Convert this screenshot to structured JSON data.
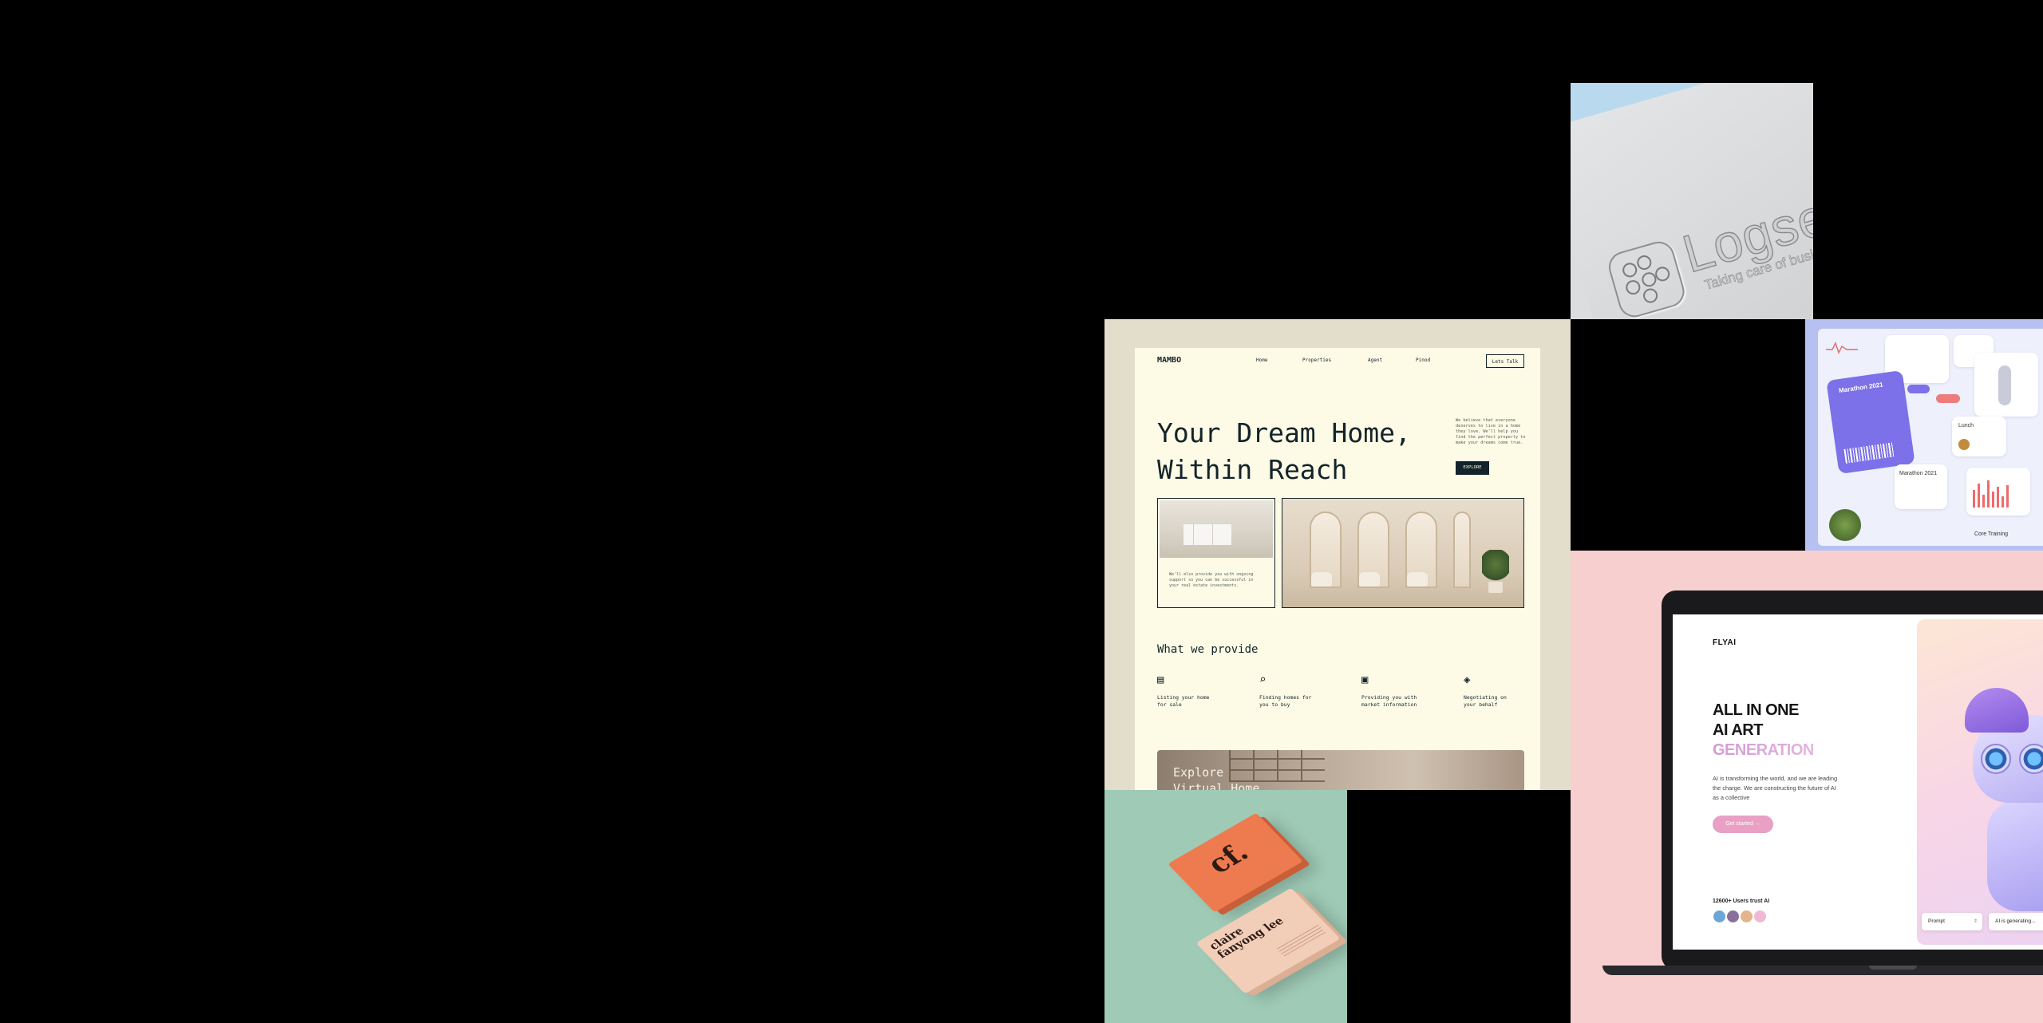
{
  "logseq": {
    "wordmark": "Logseq",
    "tagline": "Taking care of business"
  },
  "fitness": {
    "ticket_title": "Marathon 2021",
    "lunch": "Lunch",
    "marathon_card": "Marathon 2021",
    "core": "Core Training"
  },
  "mambo": {
    "brand": "MAMBO",
    "nav": [
      "Home",
      "Properties",
      "Agent",
      "Pinod"
    ],
    "talk_button": "Lets Talk",
    "hero": "Your Dream Home,\nWithin Reach",
    "blurb": "We believe that everyone deserves to live in a home they love. We'll help you find the perfect property to make your dreams come true.",
    "explore_button": "EXPLORE",
    "photo_caption": "We'll also provide you with ongoing support so you can be successful in your real estate investments.",
    "section_title": "What we provide",
    "services": [
      {
        "icon": "document-icon",
        "glyph": "▤",
        "label": "Listing your home\nfor sale"
      },
      {
        "icon": "search-home-icon",
        "glyph": "⌕",
        "label": "Finding homes for\nyou to buy"
      },
      {
        "icon": "chart-icon",
        "glyph": "▣",
        "label": "Providing you with\nmarket information"
      },
      {
        "icon": "coins-icon",
        "glyph": "◈",
        "label": "Negotiating on\nyour behalf"
      }
    ],
    "banner_title": "Explore\nVirtual Home"
  },
  "cards": {
    "logo": "cf.",
    "name": "claire\nfanyong lee"
  },
  "flyai": {
    "logo": "FLYAI",
    "headline_1": "ALL IN ONE",
    "headline_2": "AI ART",
    "headline_3": "GENERATION",
    "subtitle": "AI is transforming the world, and we are leading the charge. We are constructing the future of AI as a collective",
    "cta": "Get started  →",
    "trust": "12600+ Users trust AI",
    "prompt_label": "Prompt",
    "generating": "AI is generating..."
  },
  "colors": {
    "background": "#000000",
    "mambo_page": "#fdfbe5",
    "mambo_text": "#13232b",
    "flyai_bg": "#f8cfcf",
    "fitness_accent": "#7c71e8",
    "cards_bg": "#9fcab6"
  }
}
